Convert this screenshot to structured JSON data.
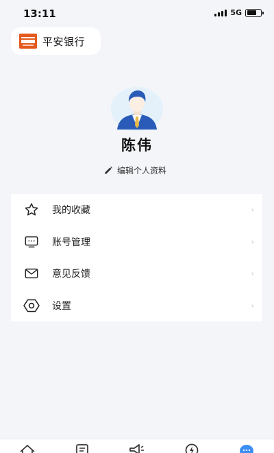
{
  "status_bar": {
    "time": "13:11",
    "network": "5G"
  },
  "brand": {
    "name": "平安银行",
    "logo_color": "#e35a1c"
  },
  "profile": {
    "name": "陈伟",
    "edit_label": "编辑个人资料"
  },
  "menu": {
    "items": [
      {
        "label": "我的收藏",
        "icon": "star-icon"
      },
      {
        "label": "账号管理",
        "icon": "monitor-icon"
      },
      {
        "label": "意见反馈",
        "icon": "mail-icon"
      },
      {
        "label": "设置",
        "icon": "settings-hexagon-icon"
      }
    ],
    "chevron": "›"
  },
  "tabbar": {
    "tabs": [
      {
        "icon": "home-icon"
      },
      {
        "icon": "document-icon"
      },
      {
        "icon": "megaphone-icon"
      },
      {
        "icon": "lightning-icon"
      },
      {
        "icon": "chat-bubble-icon",
        "active": true
      }
    ],
    "active_color": "#3a8ef6"
  }
}
